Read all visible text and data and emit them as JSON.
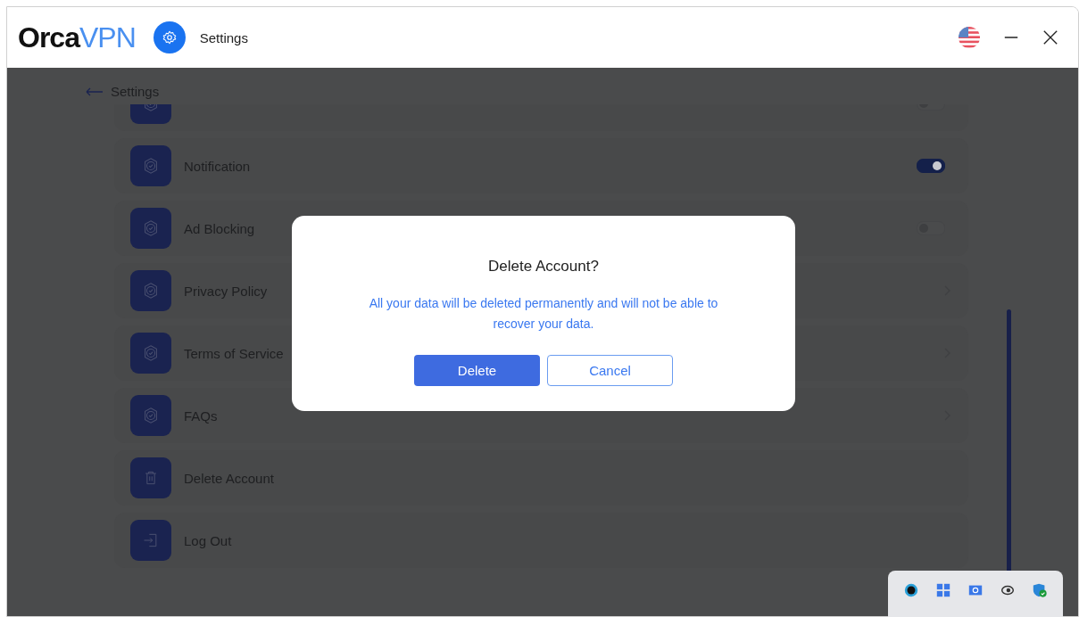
{
  "header": {
    "brand_dark": "Orca",
    "brand_accent": "VPN",
    "title": "Settings"
  },
  "back": {
    "label": "Settings"
  },
  "items": [
    {
      "kind": "toggle",
      "on": false
    },
    {
      "kind": "toggle",
      "label": "Notification",
      "on": true
    },
    {
      "kind": "toggle",
      "label": "Ad Blocking",
      "on": false
    },
    {
      "kind": "link",
      "label": "Privacy Policy"
    },
    {
      "kind": "link",
      "label": "Terms of Service"
    },
    {
      "kind": "link",
      "label": "FAQs"
    },
    {
      "kind": "delete",
      "label": "Delete Account"
    },
    {
      "kind": "logout",
      "label": "Log Out"
    }
  ],
  "dialog": {
    "title": "Delete Account?",
    "message": "All your data will be deleted permanently and will not be able to recover your data.",
    "buttons": [
      {
        "kind": "primary",
        "label": "Delete"
      },
      {
        "kind": "secondary",
        "label": "Cancel"
      }
    ]
  }
}
